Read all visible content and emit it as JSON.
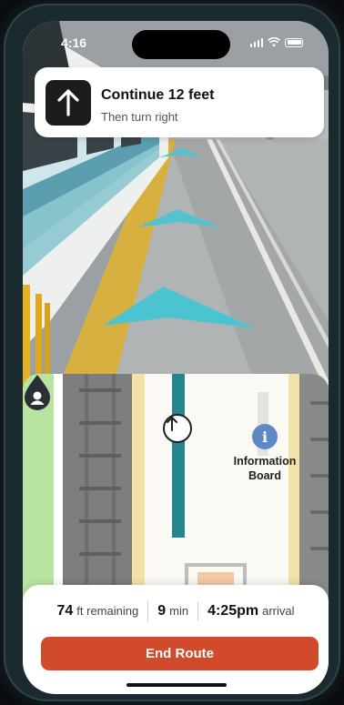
{
  "status_bar": {
    "time": "4:16",
    "icons": [
      "cellular-signal-icon",
      "wifi-icon",
      "battery-icon"
    ]
  },
  "instruction": {
    "icon": "arrow-up-icon",
    "title": "Continue 12 feet",
    "subtitle": "Then turn right"
  },
  "ar_overlay": {
    "chevron_count": 3,
    "chevron_color": "#4cc3d1"
  },
  "map": {
    "route_color": "#25868f",
    "heading_icon": "arrow-up-icon",
    "poi": {
      "icon": "info-icon",
      "glyph": "i",
      "label": "Information Board",
      "color": "#5d8ac6"
    },
    "user_icon": "user-location-pin-icon"
  },
  "trip": {
    "distance_value": "74",
    "distance_unit": "ft remaining",
    "duration_value": "9",
    "duration_unit": "min",
    "arrival_value": "4:25pm",
    "arrival_unit": "arrival"
  },
  "actions": {
    "end_route_label": "End Route",
    "end_route_color": "#d24a2c"
  }
}
